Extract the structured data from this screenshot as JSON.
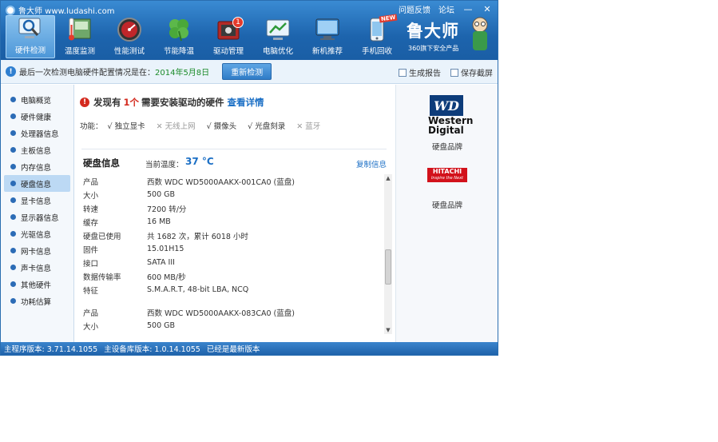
{
  "window": {
    "title": "鲁大师 www.ludashi.com",
    "top_links": [
      "问题反馈",
      "论坛"
    ],
    "minimize": "—",
    "close": "✕"
  },
  "toolbar": [
    {
      "label": "硬件检测",
      "icon": "monitor-magnifier-icon",
      "active": true
    },
    {
      "label": "温度监测",
      "icon": "thermometer-icon"
    },
    {
      "label": "性能测试",
      "icon": "speedometer-icon"
    },
    {
      "label": "节能降温",
      "icon": "clover-icon"
    },
    {
      "label": "驱动管理",
      "icon": "driver-box-icon",
      "badge": "1"
    },
    {
      "label": "电脑优化",
      "icon": "optimize-icon"
    },
    {
      "label": "新机推荐",
      "icon": "computer-icon"
    },
    {
      "label": "手机回收",
      "icon": "phone-icon",
      "tag": "NEW"
    }
  ],
  "brand": {
    "name": "鲁大师",
    "subtitle": "360旗下安全产品"
  },
  "infobar": {
    "message": "最后一次检测电脑硬件配置情况是在：",
    "date": "2014年5月8日",
    "rescan_label": "重新检测",
    "report_label": "生成报告",
    "screenshot_label": "保存截屏"
  },
  "sidebar": [
    {
      "label": "电脑概览"
    },
    {
      "label": "硬件健康"
    },
    {
      "label": "处理器信息"
    },
    {
      "label": "主板信息"
    },
    {
      "label": "内存信息"
    },
    {
      "label": "硬盘信息",
      "active": true
    },
    {
      "label": "显卡信息"
    },
    {
      "label": "显示器信息"
    },
    {
      "label": "光驱信息"
    },
    {
      "label": "网卡信息"
    },
    {
      "label": "声卡信息"
    },
    {
      "label": "其他硬件"
    },
    {
      "label": "功耗估算"
    }
  ],
  "alert": {
    "prefix": "发现有",
    "count": "1个",
    "suffix": "需要安装驱动的硬件",
    "link": "查看详情"
  },
  "features": {
    "label": "功能：",
    "items": [
      {
        "text": "√ 独立显卡",
        "on": true
      },
      {
        "text": "✕ 无线上网",
        "on": false
      },
      {
        "text": "√ 摄像头",
        "on": true
      },
      {
        "text": "√ 光盘刻录",
        "on": true
      },
      {
        "text": "✕ 蓝牙",
        "on": false
      }
    ]
  },
  "disk": {
    "title": "硬盘信息",
    "temp_label": "当前温度：",
    "temp_value": "37 °C",
    "copy_label": "复制信息",
    "rows": [
      {
        "k": "产品",
        "v": "西数 WDC WD5000AAKX-001CA0 (蓝盘)"
      },
      {
        "k": "大小",
        "v": "500 GB"
      },
      {
        "k": "转速",
        "v": "7200 转/分"
      },
      {
        "k": "缓存",
        "v": "16 MB"
      },
      {
        "k": "硬盘已使用",
        "v": "共 1682 次，累计 6018 小时"
      },
      {
        "k": "固件",
        "v": "15.01H15"
      },
      {
        "k": "接口",
        "v": "SATA III"
      },
      {
        "k": "数据传输率",
        "v": "600 MB/秒"
      },
      {
        "k": "特征",
        "v": "S.M.A.R.T,  48-bit LBA,  NCQ"
      },
      {
        "k": "",
        "v": ""
      },
      {
        "k": "产品",
        "v": "西数 WDC WD5000AAKX-083CA0 (蓝盘)"
      },
      {
        "k": "大小",
        "v": "500 GB"
      }
    ]
  },
  "brands": {
    "wd_logo": "WD",
    "wd_name": "Western Digital",
    "wd_caption": "硬盘品牌",
    "hitachi_logo": "HITACHI",
    "hitachi_sub": "Inspire the Next",
    "hitachi_caption": "硬盘品牌"
  },
  "statusbar": {
    "main_version": "主程序版本: 3.71.14.1055",
    "db_version": "主设备库版本: 1.0.14.1055",
    "status": "已经是最新版本"
  }
}
